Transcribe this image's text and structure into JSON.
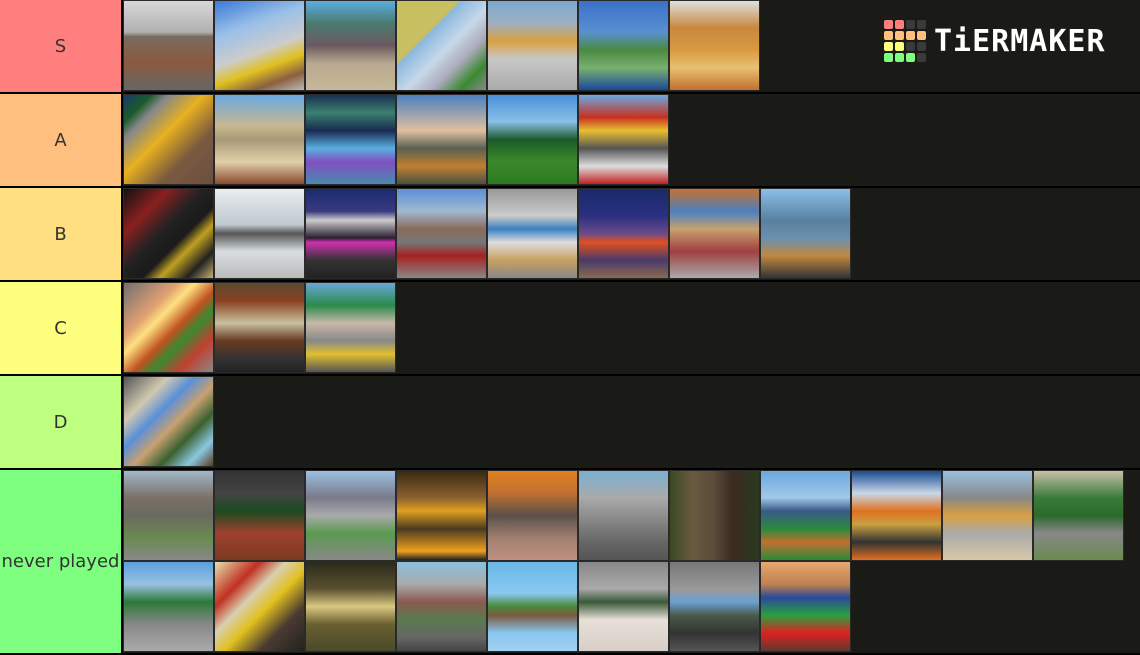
{
  "brand": {
    "name": "TiERMAKER",
    "logo_grid_colors": [
      "#ff7f7f",
      "#ff7f7f",
      "#3a3a3a",
      "#3a3a3a",
      "#ffbf7f",
      "#ffbf7f",
      "#ffbf7f",
      "#ffbf7f",
      "#ffff7f",
      "#ffff7f",
      "#3a3a3a",
      "#3a3a3a",
      "#7fff7f",
      "#7fff7f",
      "#7fff7f",
      "#3a3a3a"
    ]
  },
  "tiers": [
    {
      "label": "S",
      "color": "#ff7f7f",
      "height": 92,
      "items": [
        {
          "name": "brick-city-cloudy",
          "bg": "linear-gradient(180deg,#d8d8d8 0%,#b0b0b0 35%,#7a6a60 40%,#8a5a40 70%,#666 100%)"
        },
        {
          "name": "train-station",
          "bg": "linear-gradient(160deg,#3a7ad8 0%,#9ac0e8 30%,#ccc 55%,#e0c020 70%,#8a6040 85%,#bbb 100%)"
        },
        {
          "name": "town-plaza",
          "bg": "linear-gradient(180deg,#5aaee0 0%,#4a7a70 25%,#6a5a60 50%,#b8a890 70%,#c8b898 100%)"
        },
        {
          "name": "yellow-walls",
          "bg": "linear-gradient(135deg,#c8c060 0%,#c8c060 35%,#8ab8e0 36%,#c8d8e8 55%,#aab 70%,#3a8a30 85%,#888 100%)"
        },
        {
          "name": "rooftops",
          "bg": "linear-gradient(180deg,#7aa8d0 0%,#a0b0c0 25%,#d8a040 45%,#c8c8c8 65%,#aaa 100%)"
        },
        {
          "name": "island-park",
          "bg": "linear-gradient(180deg,#3a70c8 0%,#5a90d0 35%,#4a8a40 55%,#7ab070 75%,#1a4a9a 100%)"
        },
        {
          "name": "desert-fort",
          "bg": "linear-gradient(180deg,#dde0e0 0%,#c88840 30%,#d89a40 55%,#e8c070 75%,#c07030 100%)"
        }
      ]
    },
    {
      "label": "A",
      "color": "#ffbf7f",
      "height": 92,
      "items": [
        {
          "name": "yellow-room",
          "bg": "linear-gradient(135deg,#1a3a6a 0%,#1a5a2a 15%,#888 25%,#e8b020 45%,#7a5a40 70%,#6a5040 100%)"
        },
        {
          "name": "desert-town",
          "bg": "linear-gradient(180deg,#6aa8e0 0%,#c8b890 35%,#a89878 50%,#e0d0a8 75%,#8a4a30 100%)"
        },
        {
          "name": "aurora-ice",
          "bg": "linear-gradient(180deg,#1a3050 0%,#3a8070 20%,#1a2a50 40%,#5ab0e0 60%,#8050c0 75%,#4a8ab0 100%)"
        },
        {
          "name": "ferris-wheel",
          "bg": "linear-gradient(180deg,#4a80c0 0%,#e0c0a0 40%,#5a6050 60%,#c08030 80%,#4a5040 100%)"
        },
        {
          "name": "forest-house",
          "bg": "linear-gradient(180deg,#4a90d8 0%,#8ac0e8 30%,#1a5a2a 50%,#3a8a2a 75%,#2a7a20 100%)"
        },
        {
          "name": "container-yard",
          "bg": "linear-gradient(180deg,#6aa8e0 0%,#c83020 25%,#e8c030 40%,#555 60%,#ddd 80%,#c02020 100%)"
        }
      ]
    },
    {
      "label": "B",
      "color": "#ffdf7f",
      "height": 92,
      "items": [
        {
          "name": "night-street",
          "bg": "linear-gradient(135deg,#111 0%,#8a2020 25%,#222 45%,#1a1a1a 60%,#c0a020 70%,#222 85%,#c8b070 100%)"
        },
        {
          "name": "white-lab",
          "bg": "linear-gradient(180deg,#e8eef0 0%,#c0c8d0 40%,#555 50%,#d8dde0 70%,#bbb 100%)"
        },
        {
          "name": "neon-night",
          "bg": "linear-gradient(180deg,#1a2a70 0%,#3a3a80 25%,#ccc 35%,#2a2030 55%,#d030b0 60%,#333 80%,#222 100%)"
        },
        {
          "name": "streetcar",
          "bg": "linear-gradient(180deg,#5a90d8 0%,#a0b8d0 25%,#8a6a5a 45%,#777 60%,#a82020 75%,#888 100%)"
        },
        {
          "name": "subway-platform",
          "bg": "linear-gradient(180deg,#999 0%,#ccc 30%,#3a80c0 45%,#ddd 60%,#c8a060 80%,#888 100%)"
        },
        {
          "name": "haunted-house",
          "bg": "linear-gradient(180deg,#1a2a6a 0%,#2a3080 30%,#6a4a8a 50%,#e05020 60%,#4a3a6a 80%,#8a6a50 100%)"
        },
        {
          "name": "harbor-town",
          "bg": "linear-gradient(180deg,#c87030 0%,#4a80c0 25%,#c8a070 45%,#a04040 70%,#aaa 100%)"
        },
        {
          "name": "blue-house",
          "bg": "linear-gradient(180deg,#8ac0e8 0%,#5a80a0 35%,#6a90b0 55%,#c08840 75%,#333 100%)"
        }
      ]
    },
    {
      "label": "C",
      "color": "#ffff7f",
      "height": 92,
      "items": [
        {
          "name": "sunset-volcano",
          "bg": "linear-gradient(135deg,#707070 0%,#e0a070 30%,#ffe080 40%,#c05020 55%,#3a8a30 65%,#c04030 80%,#888 100%)"
        },
        {
          "name": "garage-interior",
          "bg": "linear-gradient(180deg,#5a4a30 0%,#8a4020 20%,#c8c0a0 45%,#6a3a20 65%,#333 85%,#222 100%)"
        },
        {
          "name": "palm-street",
          "bg": "linear-gradient(180deg,#6aa8d8 0%,#2a8a4a 25%,#c8b8a8 45%,#888 65%,#e0c030 80%,#555 100%)"
        }
      ]
    },
    {
      "label": "D",
      "color": "#bfff7f",
      "height": 92,
      "items": [
        {
          "name": "kids-bedroom",
          "bg": "linear-gradient(135deg,#555 0%,#d0c8b0 25%,#5a90d8 40%,#c8a070 55%,#3a6030 70%,#8ac8e0 85%,#5a3a20 100%)"
        }
      ]
    },
    {
      "label": "never played",
      "color": "#7fff7f",
      "height": 183,
      "items": [
        {
          "name": "stone-fortress",
          "bg": "linear-gradient(180deg,#a0b8c8 0%,#7a7068 30%,#6a6a60 50%,#6a8a50 75%,#888 100%)"
        },
        {
          "name": "courtyard-trees",
          "bg": "linear-gradient(180deg,#333 0%,#444 25%,#1a4a20 45%,#a04030 70%,#7a3a20 100%)"
        },
        {
          "name": "hill-mansion",
          "bg": "linear-gradient(180deg,#9ac0e0 0%,#7a7a8a 30%,#aaa 50%,#5a9a50 70%,#888 100%)"
        },
        {
          "name": "golden-hall",
          "bg": "linear-gradient(180deg,#3a2a10 0%,#8a6030 30%,#e0a020 45%,#4a3a20 65%,#f0a020 90%,#222 100%)"
        },
        {
          "name": "orange-warehouse",
          "bg": "linear-gradient(180deg,#e08020 0%,#c07030 25%,#5a5048 50%,#a08070 75%,#c09080 100%)"
        },
        {
          "name": "grey-city",
          "bg": "linear-gradient(180deg,#7ab0d0 0%,#aaa 30%,#888 55%,#666 80%,#555 100%)"
        },
        {
          "name": "roblox-character",
          "bg": "linear-gradient(90deg,#3a4a20 0%,#6a5a40 25%,#5a4a3a 50%,#3a2a20 70%,#2a3a20 100%)"
        },
        {
          "name": "playground",
          "bg": "linear-gradient(180deg,#6aa8e0 0%,#a0c8e8 30%,#3a5a8a 45%,#2a8a3a 65%,#c07030 80%,#2a8a3a 100%)"
        },
        {
          "name": "blue-roof-arena",
          "bg": "linear-gradient(180deg,#1a4a90 0%,#c8d8e8 25%,#e07020 45%,#c8a040 60%,#333 80%,#e07020 100%)"
        },
        {
          "name": "grey-rooftops",
          "bg": "linear-gradient(180deg,#9ac0e0 0%,#888 30%,#d8a040 50%,#aaa 70%,#d8c8a8 100%)"
        },
        {
          "name": "pine-forest",
          "bg": "linear-gradient(180deg,#c8c0a8 0%,#3a7a3a 30%,#2a6a2a 50%,#888 70%,#6a8a50 100%)"
        },
        {
          "name": "city-wall",
          "bg": "linear-gradient(180deg,#5aa0e0 0%,#9ac0e0 25%,#2a7a3a 45%,#888 70%,#aaa 100%)"
        },
        {
          "name": "subway-tunnel",
          "bg": "linear-gradient(135deg,#e8e0b0 0%,#c03020 25%,#d8d0b0 40%,#e0c020 55%,#4a3a30 75%,#222 100%)"
        },
        {
          "name": "mine-tunnel",
          "bg": "linear-gradient(180deg,#2a2a1a 0%,#5a5030 30%,#d8c880 50%,#6a6030 70%,#4a4a2a 100%)"
        },
        {
          "name": "brick-warehouse",
          "bg": "linear-gradient(180deg,#8ac0e0 0%,#aaa 25%,#8a5a50 45%,#5a7a50 65%,#666 85%,#444 100%)"
        },
        {
          "name": "sky-islands",
          "bg": "linear-gradient(180deg,#6ab8e8 0%,#8ac8f0 35%,#4a8a3a 50%,#7a5a40 60%,#8ac8f0 80%,#a0d0f0 100%)"
        },
        {
          "name": "helipad",
          "bg": "linear-gradient(180deg,#888 0%,#aaa 30%,#3a5a3a 45%,#e8e0d8 65%,#d8d0c8 100%)"
        },
        {
          "name": "grey-bunker",
          "bg": "linear-gradient(180deg,#777 0%,#999 30%,#6aa0d0 45%,#4a5a4a 60%,#333 80%,#555 100%)"
        },
        {
          "name": "colorful-market",
          "bg": "linear-gradient(180deg,#e8a870 0%,#c08050 25%,#2a4a9a 40%,#2aa040 60%,#e02020 80%,#5a3a30 100%)"
        }
      ]
    }
  ]
}
